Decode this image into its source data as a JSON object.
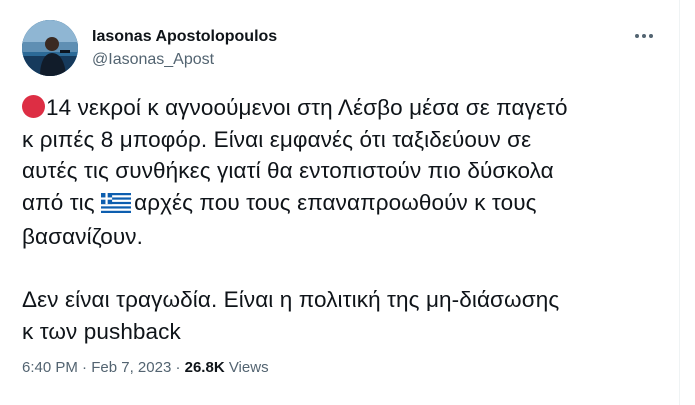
{
  "author": {
    "display_name": "Iasonas Apostolopoulos",
    "handle": "@Iasonas_Apost",
    "avatar": "profile-photo"
  },
  "more_menu": {
    "icon": "more-horizontal-icon"
  },
  "tweet": {
    "line1": "14 νεκροί κ αγνοούμενοι στη Λέσβο μέσα σε παγετό",
    "line2": "κ ριπές 8 μποφόρ. Είναι εμφανές ότι ταξιδεύουν σε",
    "line3": "αυτές τις συνθήκες γιατί θα εντοπιστούν πιο δύσκολα",
    "line4_before": "από τις",
    "line4_after": "αρχές που τους επαναπροωθούν κ τους",
    "line5": "βασανίζουν.",
    "line6": "Δεν είναι τραγωδία. Είναι η πολιτική της μη-διάσωσης",
    "line7": "κ των pushback",
    "emoji_red_circle": "red-circle-emoji",
    "emoji_flag": "greece-flag-emoji"
  },
  "meta": {
    "time": "6:40 PM",
    "separator": " · ",
    "date": "Feb 7, 2023",
    "views_count": "26.8K",
    "views_label": "Views"
  },
  "colors": {
    "text": "#0f1419",
    "secondary": "#536471",
    "red_circle": "#dd2e44",
    "flag_blue": "#0d5eaf"
  }
}
